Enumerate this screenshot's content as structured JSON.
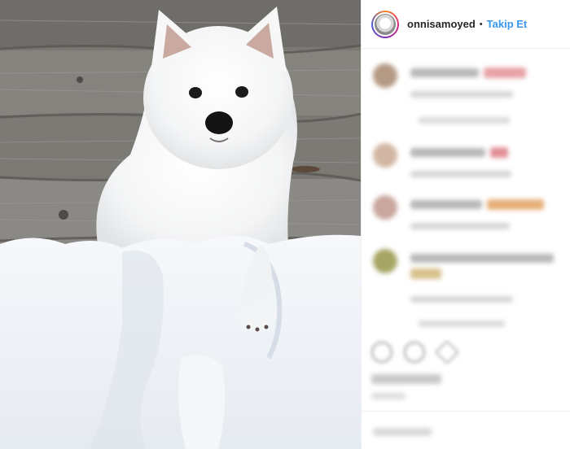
{
  "post": {
    "username": "onnisamoyed",
    "separator": "•",
    "follow_label": "Takip Et",
    "image_subject": "samoyed-puppy-in-snow"
  },
  "colors": {
    "follow_blue": "#3897f0",
    "text_dark": "#262626",
    "border": "#efefef"
  },
  "icons": {
    "like": "heart-icon",
    "comment": "comment-icon",
    "share": "share-icon"
  }
}
